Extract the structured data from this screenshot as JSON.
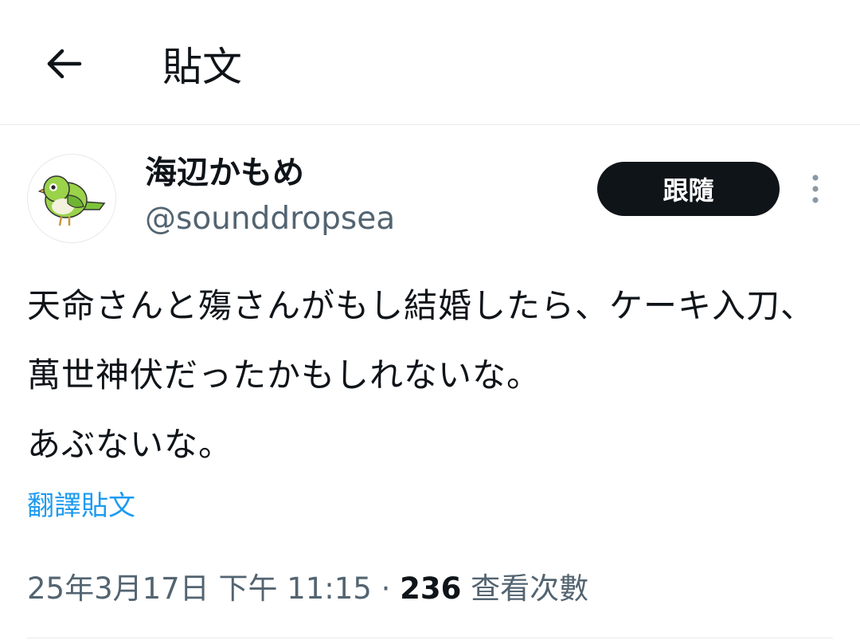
{
  "header": {
    "back_icon": "arrow-left-icon",
    "title": "貼文"
  },
  "author": {
    "avatar_icon": "green-bird-avatar",
    "display_name": "海辺かもめ",
    "handle": "@sounddropsea"
  },
  "actions": {
    "follow_label": "跟隨",
    "more_icon": "more-vertical-icon"
  },
  "post": {
    "text": "天命さんと殤さんがもし結婚したら、ケーキ入刀、萬世神伏だったかもしれないな。\nあぶないな。",
    "translate_label": "翻譯貼文"
  },
  "meta": {
    "timestamp": "25年3月17日 下午 11:15",
    "separator": " · ",
    "views_count": "236",
    "views_label": " 查看次數"
  },
  "colors": {
    "text_primary": "#0f1419",
    "text_secondary": "#536471",
    "link": "#1d9bf0",
    "follow_bg": "#0f1419",
    "divider": "#e6e9eb"
  }
}
